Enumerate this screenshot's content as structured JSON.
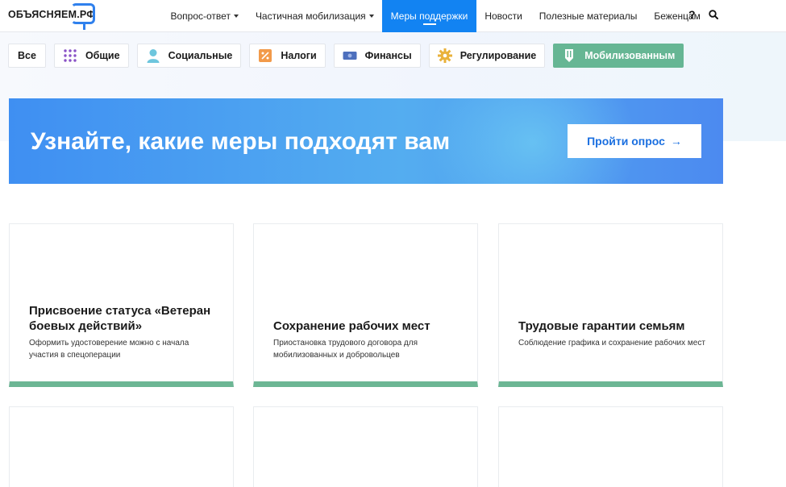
{
  "header": {
    "logo_text": "ОБЪЯСНЯЕМ.РФ",
    "nav": [
      {
        "label": "Вопрос-ответ",
        "dropdown": true,
        "active": false
      },
      {
        "label": "Частичная мобилизация",
        "dropdown": true,
        "active": false
      },
      {
        "label": "Меры поддержки",
        "dropdown": false,
        "active": true
      },
      {
        "label": "Новости",
        "dropdown": false,
        "active": false
      },
      {
        "label": "Полезные материалы",
        "dropdown": false,
        "active": false
      },
      {
        "label": "Беженцам",
        "dropdown": false,
        "active": false
      }
    ],
    "help_icon": "?",
    "search_icon": "search-icon"
  },
  "filters": [
    {
      "label": "Все",
      "icon": "",
      "active": false
    },
    {
      "label": "Общие",
      "icon": "grid-icon",
      "active": false
    },
    {
      "label": "Социальные",
      "icon": "person-icon",
      "active": false
    },
    {
      "label": "Налоги",
      "icon": "percent-icon",
      "active": false
    },
    {
      "label": "Финансы",
      "icon": "banknote-icon",
      "active": false
    },
    {
      "label": "Регулирование",
      "icon": "gear-icon",
      "active": false
    },
    {
      "label": "Мобилизованным",
      "icon": "badge-icon",
      "active": true
    }
  ],
  "banner": {
    "title": "Узнайте, какие меры подходят вам",
    "button_label": "Пройти опрос",
    "button_arrow": "→"
  },
  "cards": [
    {
      "title": "Присвоение статуса «Ветеран боевых действий»",
      "description": "Оформить удостоверение можно с начала участия в спецоперации"
    },
    {
      "title": "Сохранение рабочих мест",
      "description": "Приостановка трудового договора для мобилизованных и добровольцев"
    },
    {
      "title": "Трудовые гарантии семьям",
      "description": "Соблюдение графика и сохранение рабочих мест"
    }
  ],
  "colors": {
    "accent_blue": "#1283f2",
    "green": "#66b694",
    "banner_start": "#3f8ff2",
    "banner_end": "#4c8af0"
  }
}
